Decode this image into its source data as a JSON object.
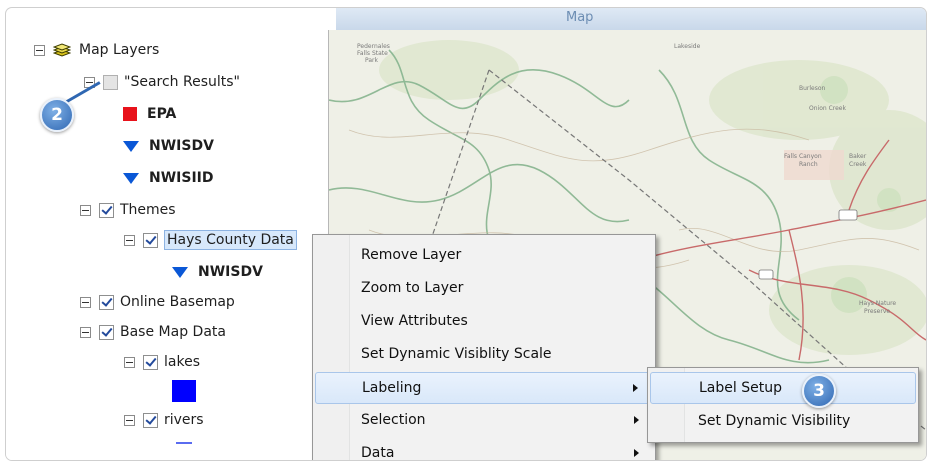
{
  "tree": {
    "root": {
      "label": "Map Layers",
      "icon": "layers-icon"
    },
    "search_results": {
      "label": "\"Search Results\"",
      "children": [
        "EPA",
        "NWISDV",
        "NWISIID"
      ]
    },
    "themes": {
      "label": "Themes"
    },
    "hays": {
      "label": "Hays County Data",
      "child": "NWISDV"
    },
    "online_basemap": {
      "label": "Online Basemap"
    },
    "base_map_data": {
      "label": "Base Map Data"
    },
    "lakes": {
      "label": "lakes",
      "swatch_color": "#0000ff"
    },
    "rivers": {
      "label": "rivers",
      "swatch_color": "#5a6cf0"
    }
  },
  "top_strip": {
    "text": "Map"
  },
  "context_menu": {
    "items": [
      {
        "label": "Remove Layer"
      },
      {
        "label": "Zoom to Layer"
      },
      {
        "label": "View Attributes"
      },
      {
        "label": "Set Dynamic Visiblity Scale"
      },
      {
        "label": "Labeling",
        "submenu": true,
        "highlighted": true
      },
      {
        "label": "Selection",
        "submenu": true
      },
      {
        "label": "Data",
        "submenu": true
      }
    ]
  },
  "submenu": {
    "items": [
      {
        "label": "Label Setup",
        "highlighted": true
      },
      {
        "label": "Set Dynamic Visibility"
      }
    ]
  },
  "callouts": {
    "two": "2",
    "three": "3"
  },
  "colors": {
    "epa": "#e8121b",
    "marker": "#0a57d6",
    "callout": "#2f67b2",
    "highlight": "#d9e8fa"
  }
}
